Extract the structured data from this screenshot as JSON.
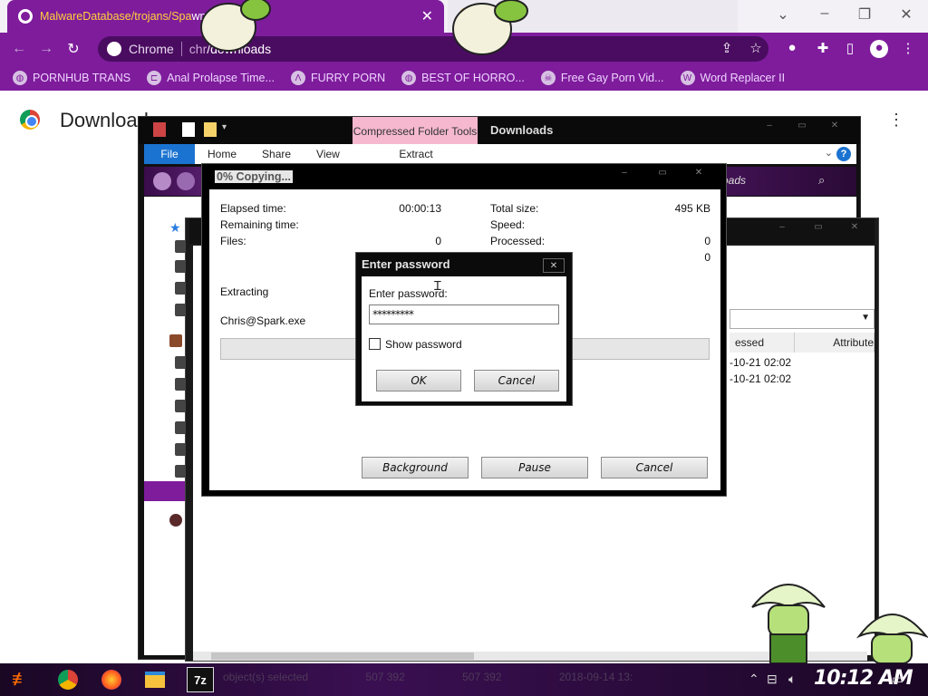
{
  "browser": {
    "active_tab": {
      "title_prefix": "MalwareDatabase/trojans/Spa",
      "title_suffix": "wnloads",
      "close": "✕"
    },
    "omnibox": {
      "chip": "Chrome",
      "url_prefix": "chr",
      "url": "/downloads"
    },
    "bookmarks": [
      {
        "label": "PORNHUB TRANS",
        "icon": "globe-icon"
      },
      {
        "label": "Anal Prolapse Time...",
        "icon": "bracket-icon"
      },
      {
        "label": "FURRY PORN",
        "icon": "lambda-icon"
      },
      {
        "label": "BEST OF HORRO...",
        "icon": "globe-icon"
      },
      {
        "label": "Free Gay Porn Vid...",
        "icon": "skull-icon"
      },
      {
        "label": "Word Replacer II",
        "icon": "wr-icon"
      }
    ],
    "page_title": "Download"
  },
  "explorer": {
    "context_tab": "Compressed Folder Tools",
    "title": "Downloads",
    "ribbon": {
      "file": "File",
      "tabs": [
        "Home",
        "Share",
        "View"
      ],
      "extract": "Extract"
    },
    "search_fragment": "oads"
  },
  "inner": {
    "columns": [
      "essed",
      "Attribute"
    ],
    "rows": [
      {
        "date": "-10-21 02:02"
      },
      {
        "date": "-10-21 02:02"
      }
    ],
    "status": [
      "object(s) selected",
      "507 392",
      "507 392",
      "2018-09-14 13:"
    ]
  },
  "progress": {
    "title": "0% Copying...",
    "elapsed_label": "Elapsed time:",
    "elapsed_value": "00:00:13",
    "remaining_label": "Remaining time:",
    "files_label": "Files:",
    "files_value": "0",
    "total_label": "Total size:",
    "total_value": "495 KB",
    "speed_label": "Speed:",
    "processed_label": "Processed:",
    "processed_value": "0",
    "extra_value": "0",
    "action": "Extracting",
    "filename": "Chris@Spark.exe",
    "buttons": {
      "background": "Background",
      "pause": "Pause",
      "cancel": "Cancel"
    }
  },
  "password_dialog": {
    "title": "Enter password",
    "label": "Enter password:",
    "masked_value": "*********",
    "show_password": "Show password",
    "ok": "OK",
    "cancel": "Cancel",
    "close": "✕"
  },
  "taskbar": {
    "sevenzip": "7z",
    "clock": "10:12 AM"
  }
}
